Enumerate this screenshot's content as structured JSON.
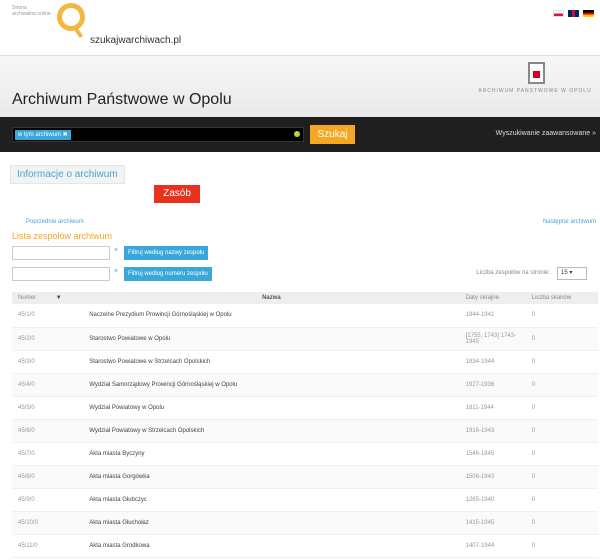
{
  "top": {
    "small_text": "Strona archiwalna online",
    "site_name": "szukajwarchiwach.pl",
    "languages": [
      "pl",
      "en",
      "de"
    ]
  },
  "archive": {
    "title": "Archiwum Państwowe w Opolu",
    "logo_text": "ARCHIWUM PAŃSTWOWE W OPOLU"
  },
  "search": {
    "tag": "w tym archiwum ✖",
    "button": "Szukaj",
    "advanced": "Wyszukiwanie zaawansowane »"
  },
  "tabs": {
    "info": "Informacje o archiwum",
    "zasob": "Zasób"
  },
  "nav": {
    "prev": "Poprzednie archiwum",
    "next": "Następne archiwum"
  },
  "list": {
    "title": "Lista zespołów archiwum",
    "filter_name_btn": "Filtruj według nazwy zespołu",
    "filter_num_btn": "Filtruj według numeru zespołu",
    "clear": "×",
    "per_page_label": "Liczba zespołów na stronie:",
    "per_page_value": "15 ▾"
  },
  "table": {
    "headers": {
      "num": "Numer",
      "name": "Nazwa",
      "dates": "Daty skrajne",
      "count": "Liczba skanów"
    },
    "rows": [
      {
        "num": "45/1/0",
        "name": "Naczelne Prezydium Prowincji Górnośląskiej w Opolu",
        "dates": "1844-1941",
        "count": "0"
      },
      {
        "num": "45/2/0",
        "name": "Starostwo Powiatowe w Opolu",
        "dates": "[1755, 1743] 1743-1945",
        "count": "0"
      },
      {
        "num": "45/3/0",
        "name": "Starostwo Powiatowe w Strzelcach Opolskich",
        "dates": "1834-1944",
        "count": "0"
      },
      {
        "num": "45/4/0",
        "name": "Wydział Samorządowy Prowincji Górnośląskiej w Opolu",
        "dates": "1927-1936",
        "count": "0"
      },
      {
        "num": "45/5/0",
        "name": "Wydział Powiatowy w Opolu",
        "dates": "1811-1944",
        "count": "0"
      },
      {
        "num": "45/6/0",
        "name": "Wydział Powiatowy w Strzelcach Opolskich",
        "dates": "1916-1943",
        "count": "0"
      },
      {
        "num": "45/7/0",
        "name": "Akta miasta Byczyny",
        "dates": "1546-1845",
        "count": "0"
      },
      {
        "num": "45/8/0",
        "name": "Akta miasta Gorgówka",
        "dates": "1506-1943",
        "count": "0"
      },
      {
        "num": "45/9/0",
        "name": "Akta miasta Głubczyc",
        "dates": "1265-1940",
        "count": "0"
      },
      {
        "num": "45/10/0",
        "name": "Akta miasta Głuchołaz",
        "dates": "1415-1945",
        "count": "0"
      },
      {
        "num": "45/11/0",
        "name": "Akta miasta Grodkowa",
        "dates": "1407-1944",
        "count": "0"
      }
    ]
  }
}
